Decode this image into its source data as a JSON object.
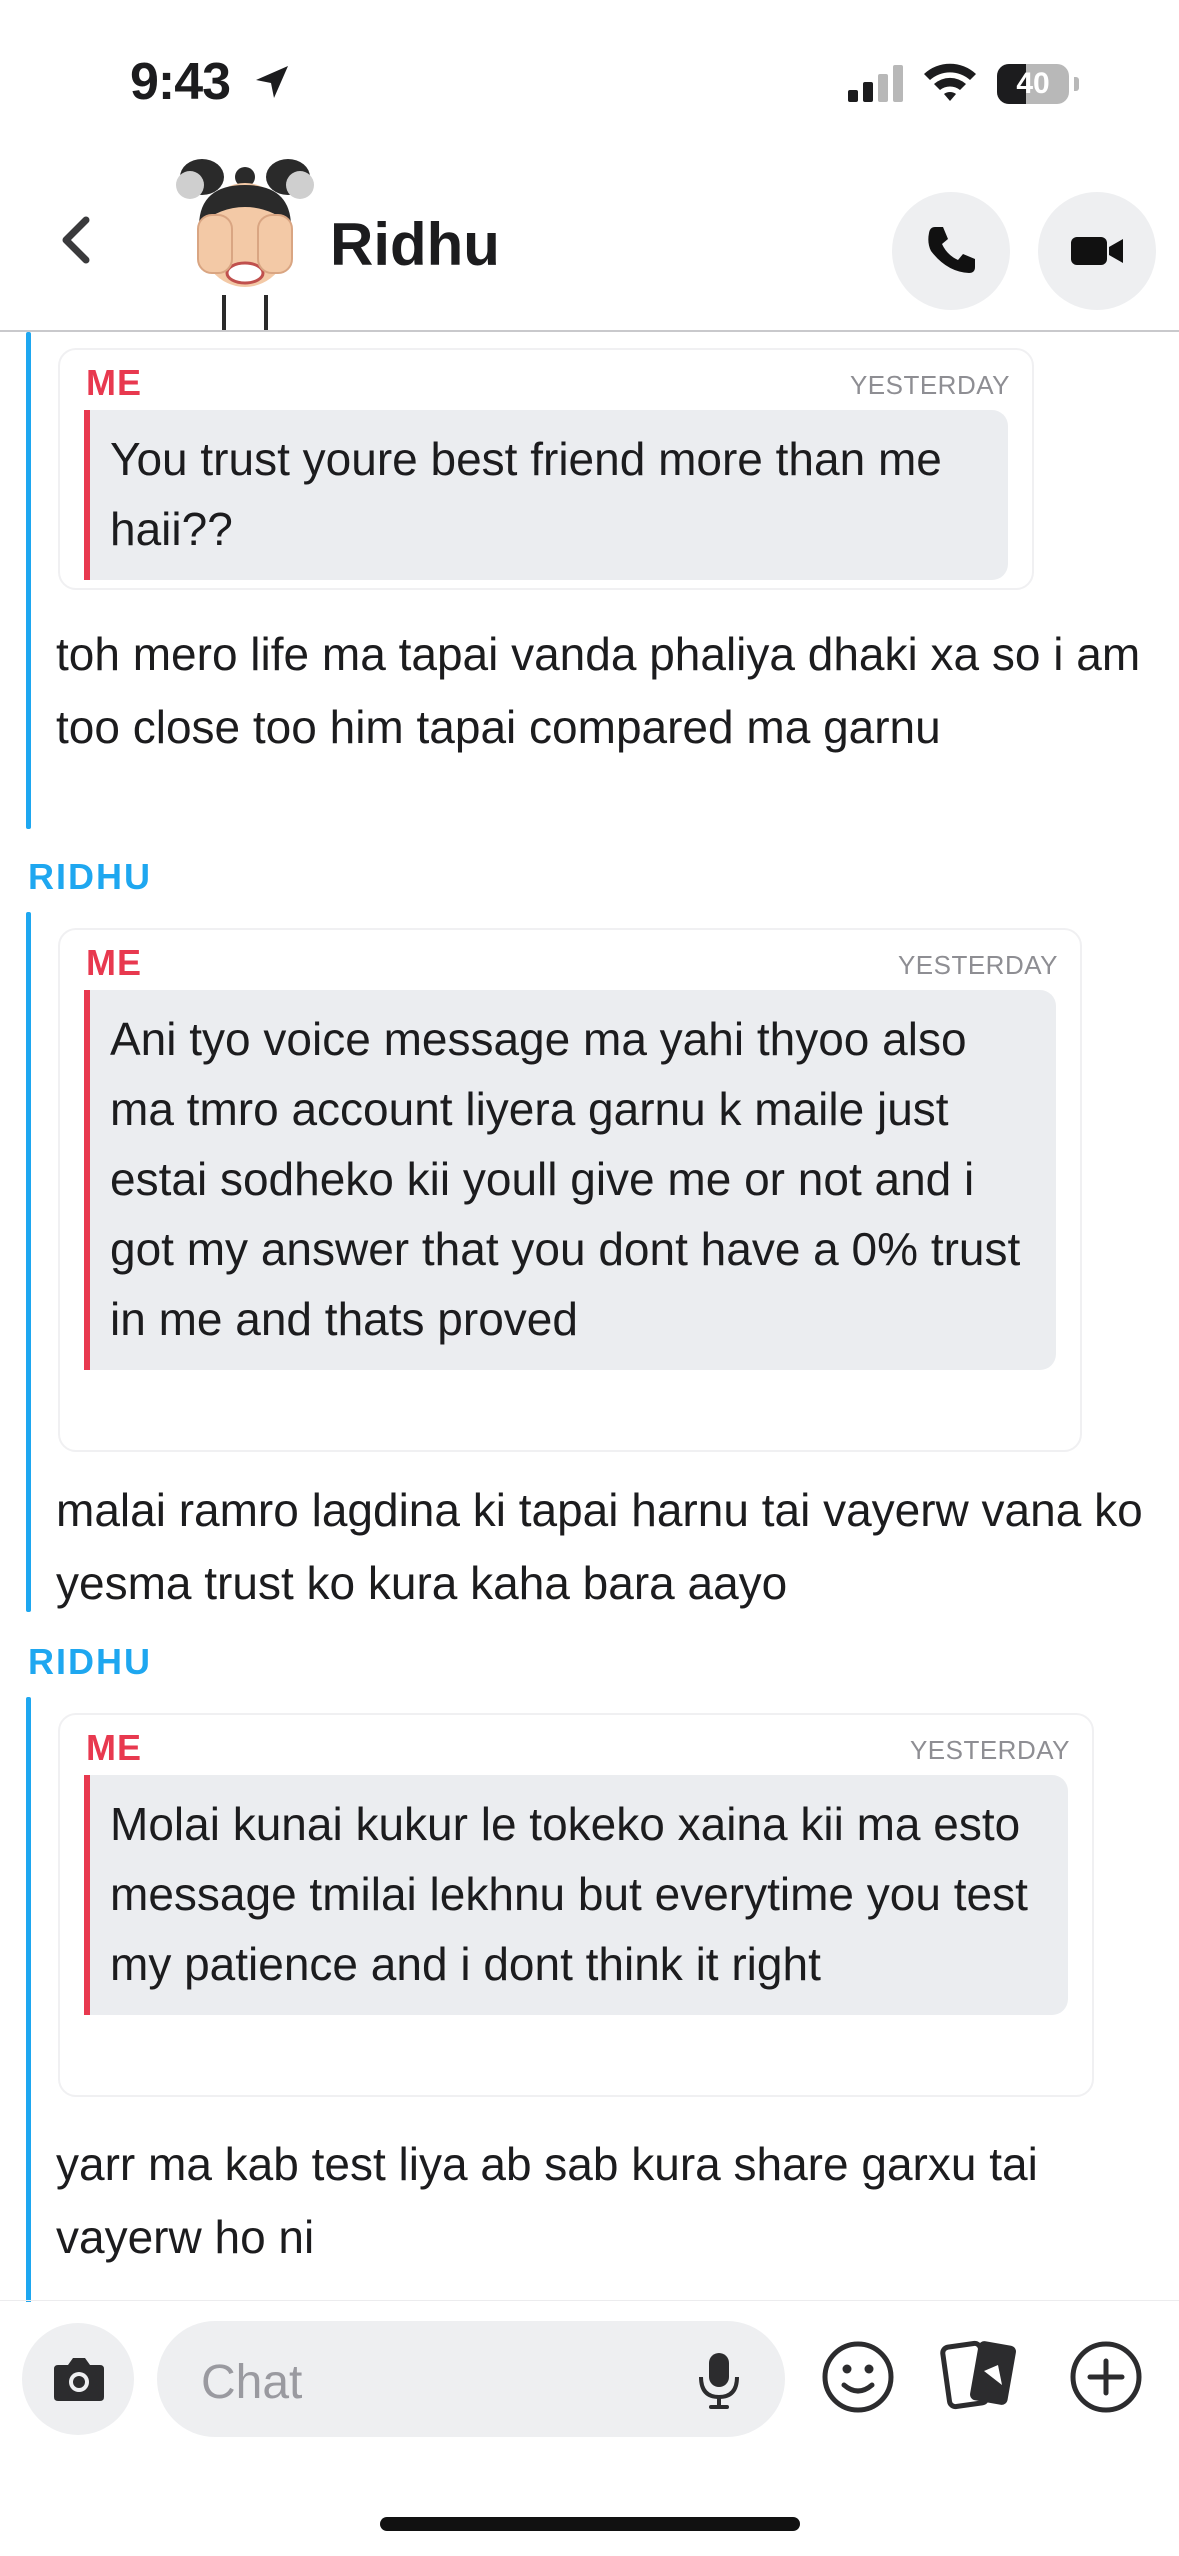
{
  "status_bar": {
    "time": "9:43",
    "battery": "40",
    "battery_level": 0.4
  },
  "header": {
    "contact_name": "Ridhu",
    "avatar": "bitmoji-avatar",
    "icons": [
      "back-chevron-icon",
      "phone-icon",
      "video-camera-icon"
    ]
  },
  "messages": [
    {
      "sender": "",
      "quote": {
        "author": "ME",
        "time": "YESTERDAY",
        "text": "You trust youre best friend more than me haii??"
      },
      "reply": "toh mero life ma tapai vanda phaliya dhaki xa so i am too close too him tapai compared ma garnu"
    },
    {
      "sender": "RIDHU",
      "quote": {
        "author": "ME",
        "time": "YESTERDAY",
        "text": "Ani tyo voice message ma yahi thyoo also ma tmro account liyera garnu k maile just estai sodheko kii youll give me or not and i got my answer that you dont have a 0% trust in me and thats proved"
      },
      "reply": "malai ramro lagdina ki tapai harnu tai vayerw vana ko yesma trust ko kura kaha bara aayo"
    },
    {
      "sender": "RIDHU",
      "quote": {
        "author": "ME",
        "time": "YESTERDAY",
        "text": "Molai kunai kukur le tokeko xaina kii ma esto message tmilai lekhnu but everytime you test my patience and i dont think it right"
      },
      "reply": "yarr ma kab test liya ab sab kura share garxu tai vayerw ho ni"
    }
  ],
  "input": {
    "placeholder": "Chat",
    "icons": [
      "camera-icon",
      "microphone-icon",
      "smiley-icon",
      "cards-icon",
      "plus-circle-icon"
    ]
  },
  "colors": {
    "accent_blue": "#1ea7f0",
    "me_red": "#e8394f",
    "quote_bg": "#ebedf0"
  }
}
